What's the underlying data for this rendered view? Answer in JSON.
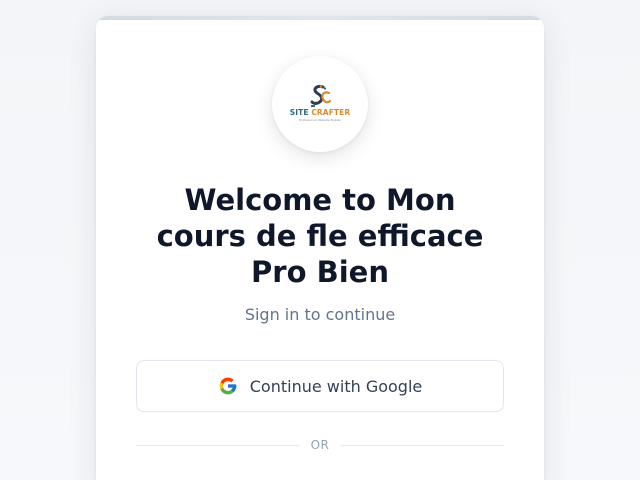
{
  "brand": {
    "logo_word_site": "SITE ",
    "logo_word_crafter": "CRAFTER",
    "logo_tagline": "Professional Website Builder",
    "colors": {
      "site": "#2d6a7a",
      "crafter": "#d98a2c"
    }
  },
  "login": {
    "title": "Welcome to Mon cours de fle efficace Pro Bien",
    "subtitle": "Sign in to continue",
    "google_button_label": "Continue with Google",
    "google_icon": "google-icon",
    "divider_text": "OR"
  }
}
